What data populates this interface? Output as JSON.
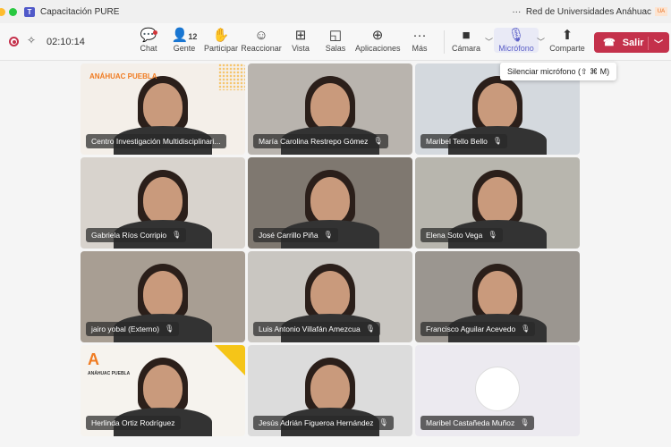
{
  "window": {
    "title": "Capacitación PURE",
    "org": "Red de Universidades Anáhuac",
    "more": "···"
  },
  "meeting": {
    "timer": "02:10:14",
    "people_count": "12"
  },
  "toolbar": [
    {
      "id": "chat",
      "label": "Chat",
      "icon": "chat-icon",
      "glyph": "💬"
    },
    {
      "id": "people",
      "label": "Gente",
      "icon": "people-icon",
      "glyph": "👤"
    },
    {
      "id": "raise",
      "label": "Participar",
      "icon": "hand-icon",
      "glyph": "✋"
    },
    {
      "id": "react",
      "label": "Reaccionar",
      "icon": "smile-icon",
      "glyph": "☺"
    },
    {
      "id": "view",
      "label": "Vista",
      "icon": "grid-icon",
      "glyph": "⊞"
    },
    {
      "id": "rooms",
      "label": "Salas",
      "icon": "rooms-icon",
      "glyph": "◱"
    },
    {
      "id": "apps",
      "label": "Aplicaciones",
      "icon": "plus-icon",
      "glyph": "⊕"
    },
    {
      "id": "more",
      "label": "Más",
      "icon": "more-icon",
      "glyph": "···"
    },
    {
      "id": "camera",
      "label": "Cámara",
      "icon": "camera-icon",
      "glyph": "■"
    },
    {
      "id": "mic",
      "label": "Micrófono",
      "icon": "microphone-icon",
      "glyph": "🎙"
    },
    {
      "id": "share",
      "label": "Comparte",
      "icon": "share-icon",
      "glyph": "⬆"
    }
  ],
  "leave": {
    "label": "Salir",
    "color": "#c4314b"
  },
  "tooltip": "Silenciar micrófono (⇧ ⌘ M)",
  "accent": "#5b5fc7",
  "participants": [
    {
      "name": "Centro Investigación Multidisciplinari...",
      "bg": "#f4efe9",
      "brand": "ANÁHUAC PUEBLA",
      "muted": false
    },
    {
      "name": "María Carolina Restrepo Gómez",
      "bg": "#b9b4ae",
      "muted": true
    },
    {
      "name": "Maribel Tello Bello",
      "bg": "#d4d9de",
      "muted": true
    },
    {
      "name": "Gabriela Ríos Corripio",
      "bg": "#d8d3cd",
      "muted": true
    },
    {
      "name": "José Carrillo Piña",
      "bg": "#7f7870",
      "muted": true
    },
    {
      "name": "Elena Soto Vega",
      "bg": "#b8b6ae",
      "muted": true
    },
    {
      "name": "jairo yobal (Externo)",
      "bg": "#a89e93",
      "muted": true
    },
    {
      "name": "Luis Antonio Villafán Amezcua",
      "bg": "#c9c6c1",
      "muted": true
    },
    {
      "name": "Francisco Aguilar Acevedo",
      "bg": "#9b9690",
      "muted": true
    },
    {
      "name": "Herlinda Ortiz Rodríguez",
      "bg": "#f6f3ee",
      "brand": "ANÁHUAC PUEBLA",
      "muted": false
    },
    {
      "name": "Jesús Adrián Figueroa Hernández",
      "bg": "#dcdcdc",
      "muted": true
    },
    {
      "name": "Maribel Castañeda Muñoz",
      "bg": "#eceaf0",
      "muted": true,
      "avatar": true
    }
  ]
}
